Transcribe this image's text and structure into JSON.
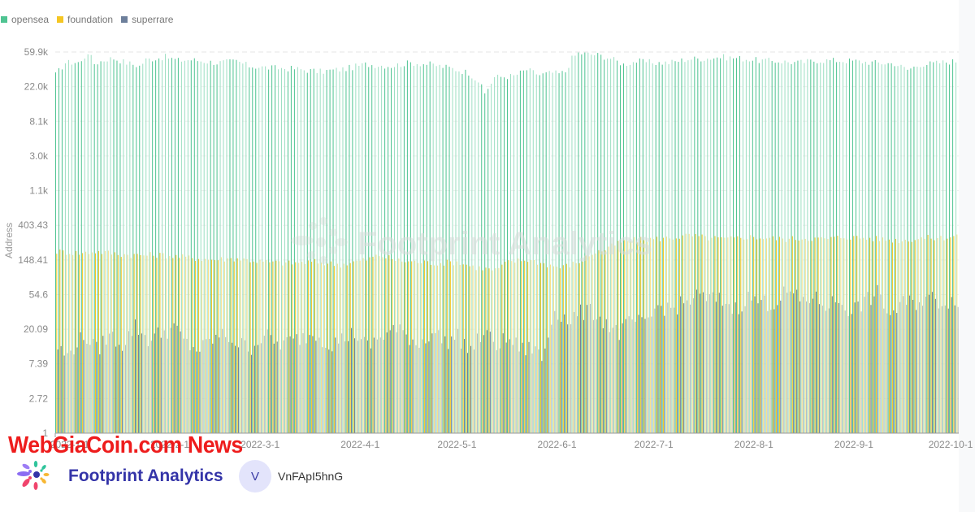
{
  "legend": [
    {
      "name": "opensea",
      "color": "#4fc492"
    },
    {
      "name": "foundation",
      "color": "#f5c623"
    },
    {
      "name": "superrare",
      "color": "#6d7f9b"
    }
  ],
  "chart_data": {
    "type": "bar",
    "subtype": "grouped",
    "title": "",
    "xlabel": "",
    "ylabel": "Address",
    "yscale": "log",
    "ylim": [
      1,
      59900
    ],
    "ytick_labels": [
      "1",
      "2.72",
      "7.39",
      "20.09",
      "54.6",
      "148.41",
      "403.43",
      "1.1k",
      "3.0k",
      "8.1k",
      "22.0k",
      "59.9k"
    ],
    "ytick_values": [
      1,
      2.72,
      7.39,
      20.09,
      54.6,
      148.41,
      403.43,
      1097,
      2981,
      8103,
      22026,
      59874
    ],
    "xtick_labels": [
      "2022-1-1",
      "2022-2-1",
      "2022-3-1",
      "2022-4-1",
      "2022-5-1",
      "2022-6-1",
      "2022-7-1",
      "2022-8-1",
      "2022-9-1",
      "2022-10-1"
    ],
    "x_start": "2021-12-28",
    "x_days": 280,
    "grid": true,
    "legend_position": "top-left",
    "watermark": "Footprint Analytics",
    "series": [
      {
        "name": "opensea",
        "color": "#4fc492",
        "anchors": [
          [
            0,
            31000
          ],
          [
            3,
            44000
          ],
          [
            8,
            45000
          ],
          [
            9,
            52000
          ],
          [
            10,
            60000
          ],
          [
            12,
            43000
          ],
          [
            16,
            49000
          ],
          [
            18,
            50000
          ],
          [
            22,
            44000
          ],
          [
            26,
            40000
          ],
          [
            28,
            48000
          ],
          [
            34,
            52000
          ],
          [
            38,
            47000
          ],
          [
            42,
            48000
          ],
          [
            50,
            44000
          ],
          [
            56,
            46000
          ],
          [
            60,
            40000
          ],
          [
            66,
            38000
          ],
          [
            74,
            37000
          ],
          [
            82,
            34000
          ],
          [
            90,
            37000
          ],
          [
            96,
            42000
          ],
          [
            104,
            40000
          ],
          [
            110,
            44000
          ],
          [
            116,
            42000
          ],
          [
            122,
            38000
          ],
          [
            128,
            33000
          ],
          [
            131,
            26000
          ],
          [
            133,
            18000
          ],
          [
            136,
            29000
          ],
          [
            142,
            30000
          ],
          [
            146,
            36000
          ],
          [
            150,
            31000
          ],
          [
            154,
            33000
          ],
          [
            156,
            32000
          ],
          [
            158,
            34000
          ],
          [
            160,
            50000
          ],
          [
            162,
            58000
          ],
          [
            168,
            55000
          ],
          [
            172,
            50000
          ],
          [
            176,
            42000
          ],
          [
            180,
            46000
          ],
          [
            186,
            44000
          ],
          [
            190,
            44000
          ],
          [
            196,
            49000
          ],
          [
            202,
            50000
          ],
          [
            206,
            52000
          ],
          [
            212,
            50000
          ],
          [
            218,
            47000
          ],
          [
            224,
            46000
          ],
          [
            230,
            44000
          ],
          [
            236,
            47000
          ],
          [
            242,
            47000
          ],
          [
            248,
            46000
          ],
          [
            254,
            44000
          ],
          [
            260,
            43000
          ],
          [
            264,
            36000
          ],
          [
            268,
            42000
          ],
          [
            272,
            43000
          ],
          [
            276,
            45000
          ],
          [
            279,
            46000
          ]
        ]
      },
      {
        "name": "foundation",
        "color": "#f5c623",
        "anchors": [
          [
            0,
            190
          ],
          [
            8,
            180
          ],
          [
            12,
            190
          ],
          [
            20,
            175
          ],
          [
            26,
            170
          ],
          [
            32,
            172
          ],
          [
            40,
            160
          ],
          [
            48,
            150
          ],
          [
            56,
            155
          ],
          [
            64,
            140
          ],
          [
            72,
            135
          ],
          [
            80,
            140
          ],
          [
            88,
            130
          ],
          [
            96,
            150
          ],
          [
            100,
            170
          ],
          [
            106,
            145
          ],
          [
            112,
            140
          ],
          [
            118,
            135
          ],
          [
            124,
            140
          ],
          [
            130,
            120
          ],
          [
            136,
            110
          ],
          [
            140,
            140
          ],
          [
            146,
            150
          ],
          [
            152,
            130
          ],
          [
            156,
            120
          ],
          [
            158,
            125
          ],
          [
            162,
            140
          ],
          [
            166,
            180
          ],
          [
            170,
            200
          ],
          [
            174,
            240
          ],
          [
            178,
            260
          ],
          [
            184,
            270
          ],
          [
            190,
            280
          ],
          [
            196,
            300
          ],
          [
            202,
            280
          ],
          [
            208,
            270
          ],
          [
            214,
            290
          ],
          [
            220,
            280
          ],
          [
            226,
            270
          ],
          [
            232,
            280
          ],
          [
            238,
            270
          ],
          [
            244,
            290
          ],
          [
            250,
            280
          ],
          [
            256,
            270
          ],
          [
            262,
            260
          ],
          [
            268,
            280
          ],
          [
            274,
            280
          ],
          [
            279,
            300
          ]
        ]
      },
      {
        "name": "superrare",
        "color": "#6d7f9b",
        "anchors": [
          [
            0,
            12
          ],
          [
            3,
            9
          ],
          [
            6,
            14
          ],
          [
            9,
            16
          ],
          [
            12,
            11
          ],
          [
            16,
            17
          ],
          [
            20,
            13
          ],
          [
            24,
            22
          ],
          [
            28,
            15
          ],
          [
            32,
            18
          ],
          [
            36,
            21
          ],
          [
            40,
            13
          ],
          [
            44,
            11
          ],
          [
            48,
            15
          ],
          [
            52,
            17
          ],
          [
            56,
            13
          ],
          [
            60,
            12
          ],
          [
            64,
            17
          ],
          [
            68,
            13
          ],
          [
            72,
            14
          ],
          [
            76,
            16
          ],
          [
            80,
            18
          ],
          [
            84,
            13
          ],
          [
            88,
            15
          ],
          [
            92,
            18
          ],
          [
            96,
            12
          ],
          [
            100,
            16
          ],
          [
            104,
            20
          ],
          [
            108,
            17
          ],
          [
            112,
            13
          ],
          [
            116,
            19
          ],
          [
            120,
            14
          ],
          [
            124,
            16
          ],
          [
            128,
            11
          ],
          [
            132,
            18
          ],
          [
            136,
            13
          ],
          [
            140,
            15
          ],
          [
            144,
            11
          ],
          [
            148,
            12
          ],
          [
            150,
            8
          ],
          [
            154,
            36
          ],
          [
            158,
            26
          ],
          [
            162,
            32
          ],
          [
            166,
            33
          ],
          [
            170,
            24
          ],
          [
            174,
            18
          ],
          [
            178,
            26
          ],
          [
            182,
            22
          ],
          [
            186,
            40
          ],
          [
            190,
            36
          ],
          [
            194,
            42
          ],
          [
            198,
            52
          ],
          [
            202,
            48
          ],
          [
            206,
            46
          ],
          [
            210,
            36
          ],
          [
            214,
            50
          ],
          [
            218,
            44
          ],
          [
            222,
            42
          ],
          [
            226,
            60
          ],
          [
            230,
            46
          ],
          [
            234,
            50
          ],
          [
            238,
            40
          ],
          [
            242,
            46
          ],
          [
            246,
            34
          ],
          [
            250,
            44
          ],
          [
            254,
            56
          ],
          [
            258,
            30
          ],
          [
            262,
            42
          ],
          [
            266,
            44
          ],
          [
            270,
            50
          ],
          [
            274,
            44
          ],
          [
            279,
            48
          ]
        ]
      }
    ]
  },
  "watermark_news": "WebGiaCoin.com News",
  "footer": {
    "brand_name": "Footprint Analytics",
    "avatar_initial": "V",
    "username": "VnFApI5hnG"
  }
}
